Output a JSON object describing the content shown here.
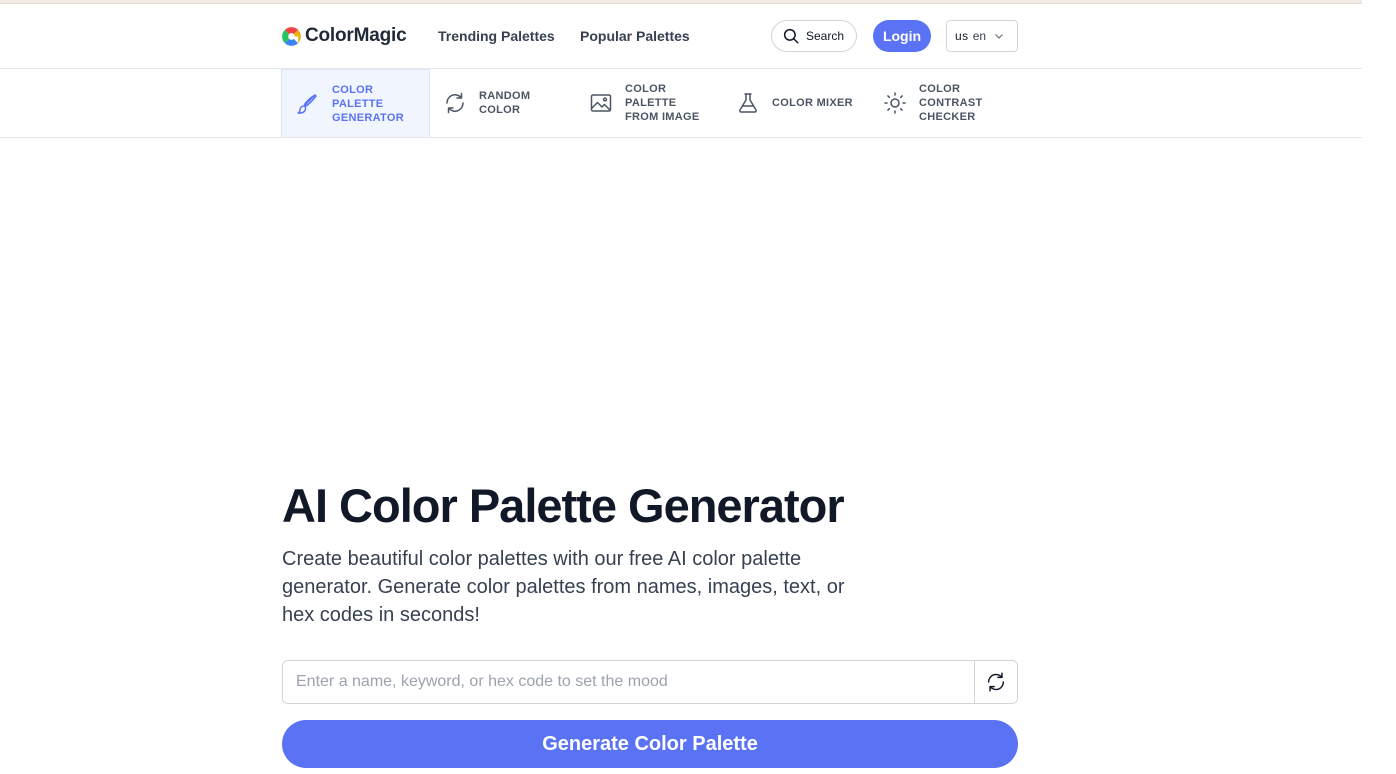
{
  "header": {
    "logo_text": "ColorMagic",
    "nav": {
      "trending": "Trending Palettes",
      "popular": "Popular Palettes"
    },
    "search_label": "Search",
    "login_label": "Login",
    "language": {
      "flag": "us",
      "code": "en"
    }
  },
  "tools": [
    {
      "label": "COLOR\nPALETTE\nGENERATOR",
      "icon": "brush-icon",
      "active": true
    },
    {
      "label": "RANDOM\nCOLOR",
      "icon": "refresh-icon",
      "active": false
    },
    {
      "label": "COLOR\nPALETTE\nFROM IMAGE",
      "icon": "image-icon",
      "active": false
    },
    {
      "label": "COLOR MIXER",
      "icon": "flask-icon",
      "active": false
    },
    {
      "label": "COLOR\nCONTRAST\nCHECKER",
      "icon": "sun-icon",
      "active": false
    }
  ],
  "hero": {
    "title": "AI Color Palette Generator",
    "subtitle": "Create beautiful color palettes with our free AI color palette generator. Generate color palettes from names, images, text, or hex codes in seconds!"
  },
  "mood_input": {
    "placeholder": "Enter a name, keyword, or hex code to set the mood",
    "value": ""
  },
  "generate_label": "Generate Color Palette",
  "colors": {
    "accent": "#5a73f5",
    "active_tab_bg": "#f1f6fe",
    "logo": [
      "#f97316",
      "#eab308",
      "#22c55e",
      "#3b82f6",
      "#ef4444"
    ]
  }
}
